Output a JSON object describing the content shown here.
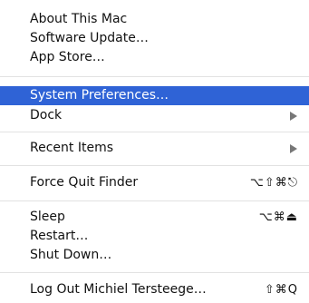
{
  "menu": {
    "about": "About This Mac",
    "software_update": "Software Update…",
    "app_store": "App Store…",
    "system_preferences": "System Preferences…",
    "dock": "Dock",
    "recent_items": "Recent Items",
    "force_quit": "Force Quit Finder",
    "force_quit_shortcut": "⌥⇧⌘⎋",
    "sleep": "Sleep",
    "sleep_shortcut": "⌥⌘⏏",
    "restart": "Restart…",
    "shut_down": "Shut Down…",
    "log_out": "Log Out Michiel Tersteege…",
    "log_out_shortcut": "⇧⌘Q"
  },
  "colors": {
    "highlight": "#2f63d6",
    "separator": "#e2e2e2",
    "arrow": "#777777"
  },
  "icons": {
    "submenu_arrow": "chevron-right-icon"
  }
}
